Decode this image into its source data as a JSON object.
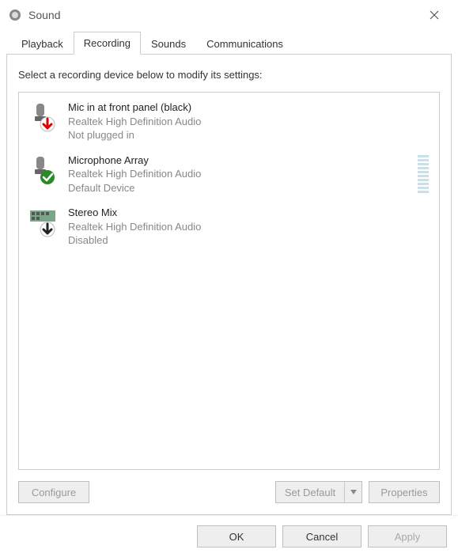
{
  "window": {
    "title": "Sound"
  },
  "tabs": [
    {
      "label": "Playback"
    },
    {
      "label": "Recording"
    },
    {
      "label": "Sounds"
    },
    {
      "label": "Communications"
    }
  ],
  "active_tab": 1,
  "instruction": "Select a recording device below to modify its settings:",
  "devices": [
    {
      "name": "Mic in at front panel (black)",
      "driver": "Realtek High Definition Audio",
      "status": "Not plugged in",
      "badge": "unplugged"
    },
    {
      "name": "Microphone Array",
      "driver": "Realtek High Definition Audio",
      "status": "Default Device",
      "badge": "default",
      "show_level": true
    },
    {
      "name": "Stereo Mix",
      "driver": "Realtek High Definition Audio",
      "status": "Disabled",
      "badge": "disabled"
    }
  ],
  "buttons": {
    "configure": "Configure",
    "set_default": "Set Default",
    "properties": "Properties",
    "ok": "OK",
    "cancel": "Cancel",
    "apply": "Apply"
  }
}
